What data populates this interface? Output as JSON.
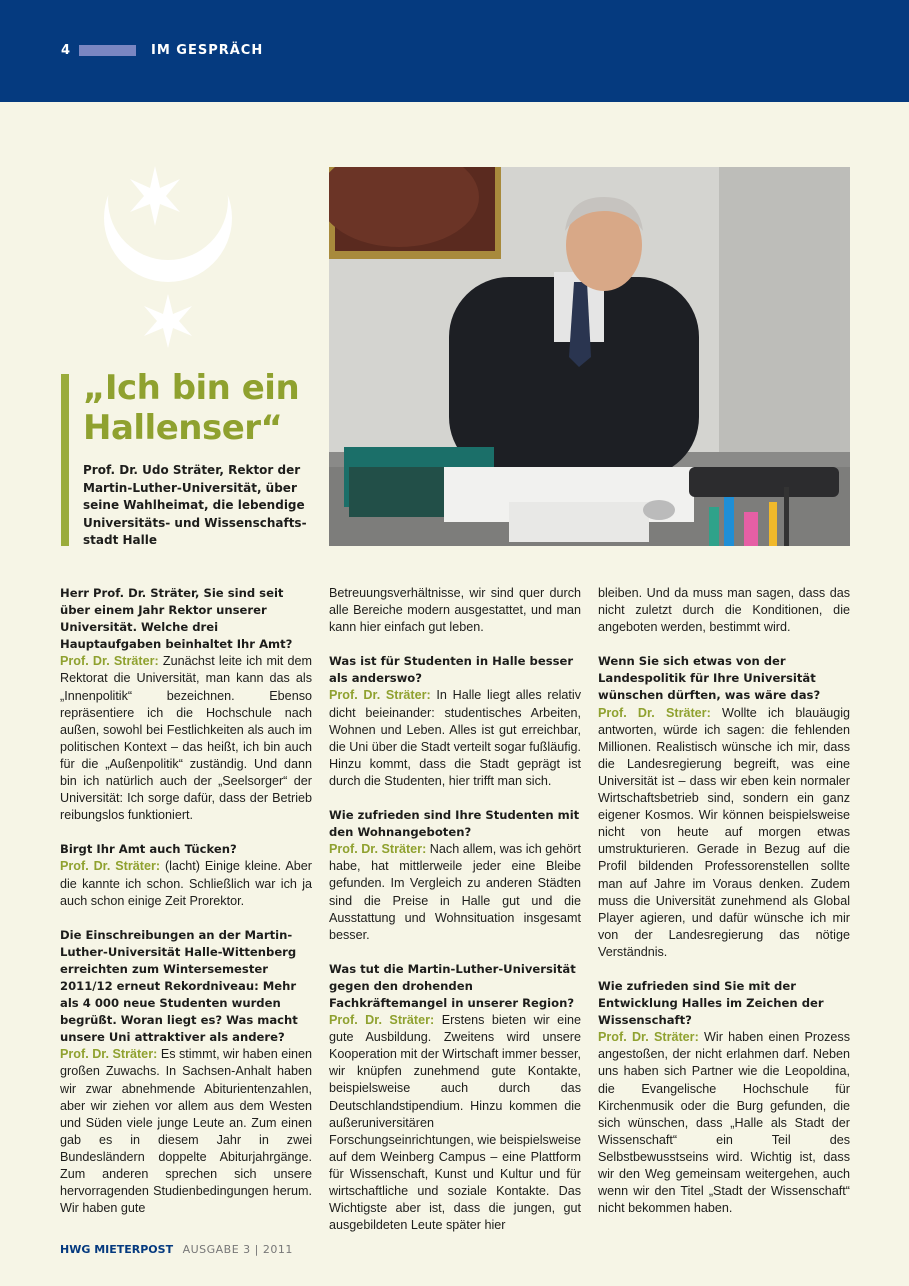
{
  "header": {
    "page_number": "4",
    "section": "IM GESPRÄCH",
    "bar_color": "#053a7f",
    "accent_color": "#8fa12f"
  },
  "headline": {
    "line1": "„Ich bin ein",
    "line2": "Hallenser“"
  },
  "subhead": "Prof. Dr. Udo Sträter, Rektor der Martin-Luther-Universität, über seine Wahlheimat, die lebendige Universitäts- und Wissenschafts-stadt Halle",
  "photo_icon": "portrait-photo",
  "emblem_icon": "halle-crescent-stars-emblem",
  "article": {
    "speaker": "Prof. Dr. Sträter:",
    "col1": {
      "q1": "Herr Prof. Dr. Sträter, Sie sind seit über einem Jahr Rektor unserer Universität. Welche drei Hauptaufgaben beinhaltet Ihr Amt?",
      "a1": "Zunächst leite ich mit dem Rektorat die Universität, man kann das als „Innenpolitik“ bezeichnen. Ebenso repräsentiere ich die Hochschule nach außen, sowohl bei Festlichkeiten als auch im politischen Kontext – das heißt, ich bin auch für die „Außenpolitik“ zuständig. Und dann bin ich natürlich auch der „Seelsorger“ der Universität: Ich sorge dafür, dass der Betrieb reibungslos funktioniert.",
      "q2": "Birgt Ihr Amt auch Tücken?",
      "a2": "(lacht) Einige kleine. Aber die kannte ich schon. Schließlich war ich ja auch schon einige Zeit Prorektor.",
      "q3": "Die Einschreibungen an der Martin-Luther-Universität Halle-Wittenberg erreichten zum Wintersemester 2011/12 erneut Rekordniveau: Mehr als 4 000 neue Studenten wurden begrüßt. Woran liegt es? Was macht unsere Uni attraktiver als andere?",
      "a3": "Es stimmt, wir haben einen großen Zuwachs. In Sachsen-Anhalt haben wir zwar abnehmende Abiturientenzahlen, aber wir ziehen vor allem aus dem Westen und Süden viele junge Leute an. Zum einen gab es in diesem Jahr in zwei Bundesländern doppelte Abiturjahrgänge. Zum anderen sprechen sich unsere hervorragenden Studienbedingungen herum. Wir haben gute"
    },
    "col2": {
      "a3_cont": "Betreuungsverhältnisse, wir sind quer durch alle Bereiche modern ausgestattet, und man kann hier einfach gut leben.",
      "q4": "Was ist für Studenten in Halle besser als anderswo?",
      "a4": "In Halle liegt alles relativ dicht beieinander: studentisches Arbeiten, Wohnen und Leben. Alles ist gut erreichbar, die Uni über die Stadt verteilt sogar fußläufig. Hinzu kommt, dass die Stadt geprägt ist durch die Studenten, hier trifft man sich.",
      "q5": "Wie zufrieden sind Ihre Studenten mit den Wohnangeboten?",
      "a5": "Nach allem, was ich gehört habe, hat mittlerweile jeder eine Bleibe gefunden. Im Vergleich zu anderen Städten sind die Preise in Halle gut und die Ausstattung und Wohnsituation insgesamt besser.",
      "q6": "Was tut die Martin-Luther-Universität gegen den drohenden Fachkräftemangel in unserer Region?",
      "a6": "Erstens bieten wir eine gute Ausbildung. Zweitens wird unsere Kooperation mit der Wirtschaft immer besser, wir knüpfen zunehmend gute Kontakte, beispielsweise auch durch das Deutschlandstipendium. Hinzu kommen die außeruniversitären Forschungseinrichtungen, wie beispielsweise auf dem Weinberg Campus – eine Plattform für Wissenschaft, Kunst und Kultur und für wirtschaftliche und soziale Kontakte. Das Wichtigste aber ist, dass die jungen, gut ausgebildeten Leute später hier"
    },
    "col3": {
      "a6_cont": "bleiben. Und da muss man sagen, dass das nicht zuletzt durch die Konditionen, die angeboten werden, bestimmt wird.",
      "q7": "Wenn Sie sich etwas von der Landespolitik für Ihre Universität wünschen dürften, was wäre das?",
      "a7": "Wollte ich blauäugig antworten, würde ich sagen: die fehlenden Millionen. Realistisch wünsche ich mir, dass die Landesregierung begreift, was eine Universität ist – dass wir eben kein normaler Wirtschaftsbetrieb sind, sondern ein ganz eigener Kosmos. Wir können beispielsweise nicht von heute auf morgen etwas umstrukturieren. Gerade in Bezug auf die Profil bildenden Professorenstellen sollte man auf Jahre im Voraus denken. Zudem muss die Universität zunehmend als Global Player agieren, und dafür wünsche ich mir von der Landesregierung das nötige Verständnis.",
      "q8": "Wie zufrieden sind Sie mit der Entwicklung Halles im Zeichen der Wissenschaft?",
      "a8": "Wir haben einen Prozess angestoßen, der nicht erlahmen darf. Neben uns haben sich Partner wie die Leopoldina, die Evangelische Hochschule für Kirchenmusik oder die Burg gefunden, die sich wünschen, dass „Halle als Stadt der Wissenschaft“ ein Teil des Selbstbewusstseins wird. Wichtig ist, dass wir den Weg gemeinsam weitergehen, auch wenn wir den Titel „Stadt der Wissenschaft“ nicht bekommen haben."
    }
  },
  "footer": {
    "brand": "HWG MIETERPOST",
    "issue": "AUSGABE 3 | 2011"
  }
}
